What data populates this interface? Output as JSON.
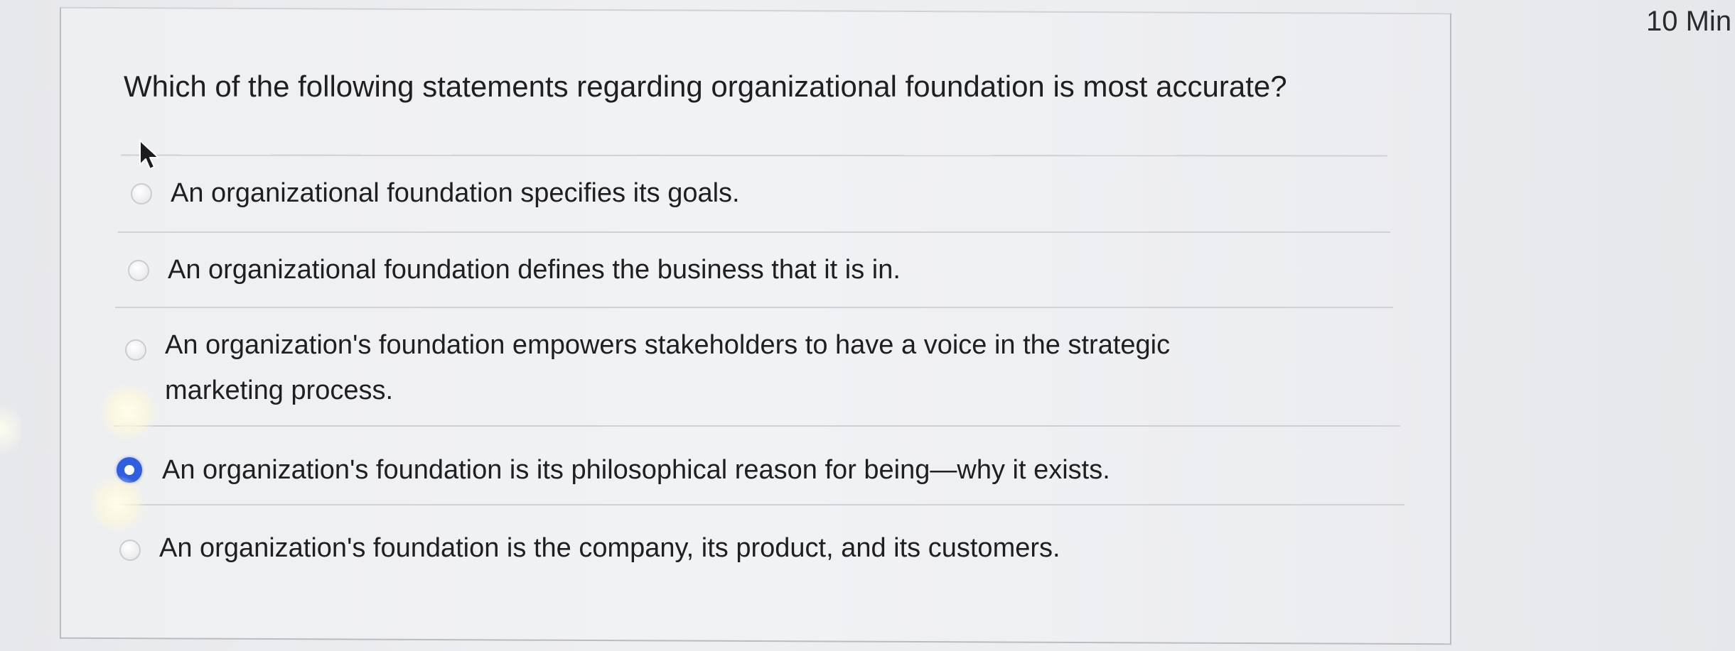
{
  "timer": {
    "label": "10 Min"
  },
  "question": {
    "text": "Which of the following statements regarding organizational foundation is most accurate?"
  },
  "options": [
    {
      "label": "An organizational foundation specifies its goals.",
      "selected": false
    },
    {
      "label": "An organizational foundation defines the business that it is in.",
      "selected": false
    },
    {
      "label": "An organization's foundation empowers stakeholders to have a voice in the strategic marketing process.",
      "selected": false
    },
    {
      "label": "An organization's foundation is its philosophical reason for being—why it exists.",
      "selected": true
    },
    {
      "label": "An organization's foundation is the company, its product, and its customers.",
      "selected": false
    }
  ],
  "colors": {
    "selected_radio": "#2f5fe0",
    "divider": "#cfd1d6",
    "background": "#eceef0"
  },
  "icons": {
    "cursor": "mouse-pointer-icon",
    "radio": "radio-button-icon"
  }
}
